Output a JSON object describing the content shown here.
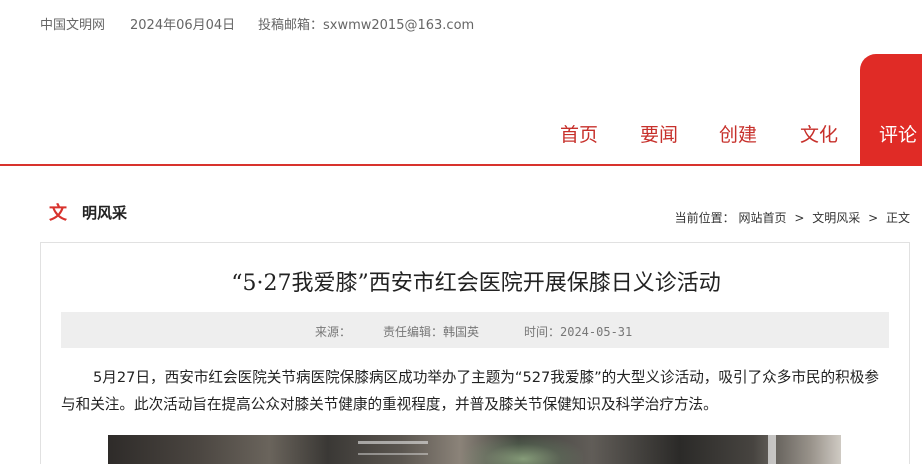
{
  "topbar": {
    "site": "中国文明网",
    "date": "2024年06月04日",
    "email": "投稿邮箱：sxwmw2015@163.com"
  },
  "nav": {
    "items": [
      {
        "label": "首页"
      },
      {
        "label": "要闻"
      },
      {
        "label": "创建"
      },
      {
        "label": "文化"
      }
    ],
    "active": "评论",
    "accent_color": "#e02b26"
  },
  "section": {
    "icon_glyph": "文",
    "title": "明风采"
  },
  "breadcrumb": {
    "prefix": "当前位置：",
    "home": "网站首页",
    "category": "文明风采",
    "current": "正文",
    "separator": ">"
  },
  "article": {
    "title": "“5·27我爱膝”西安市红会医院开展保膝日义诊活动",
    "source": "来源：",
    "editor": "责任编辑：韩国英",
    "time": "时间：2024-05-31",
    "paragraph": "5月27日，西安市红会医院关节病医院保膝病区成功举办了主题为“527我爱膝”的大型义诊活动，吸引了众多市民的积极参与和关注。此次活动旨在提高公众对膝关节健康的重视程度，并普及膝关节保健知识及科学治疗方法。"
  }
}
